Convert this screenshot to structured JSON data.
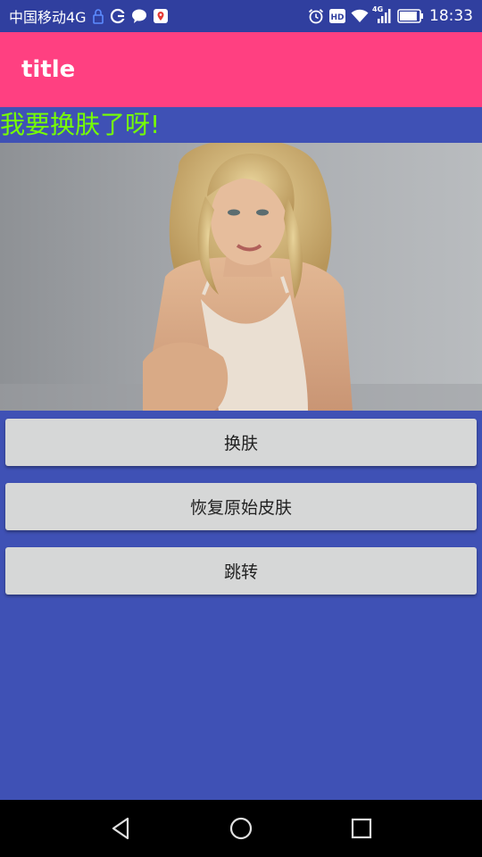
{
  "status_bar": {
    "carrier": "中国移动4G",
    "time": "18:33",
    "network_badge": "4G",
    "left_icons": [
      "lock-notification-icon",
      "sync-icon",
      "chat-icon",
      "map-pin-icon"
    ],
    "right_icons": [
      "alarm-icon",
      "hd-icon",
      "wifi-icon",
      "signal-icon",
      "battery-icon"
    ],
    "battery_level": 0.9
  },
  "app_bar": {
    "title": "title"
  },
  "content": {
    "headline": "我要换肤了呀!",
    "photo": "portrait-photo"
  },
  "buttons": {
    "change_skin": "换肤",
    "restore_skin": "恢复原始皮肤",
    "jump": "跳转"
  },
  "nav_bar": {
    "icons": [
      "back-icon",
      "home-icon",
      "recents-icon"
    ]
  },
  "colors": {
    "status_bar": "#303f9f",
    "app_bar": "#ff4081",
    "background": "#3f51b5",
    "headline_text": "#76ff03",
    "button": "#d6d7d7",
    "nav_bar": "#000000"
  }
}
